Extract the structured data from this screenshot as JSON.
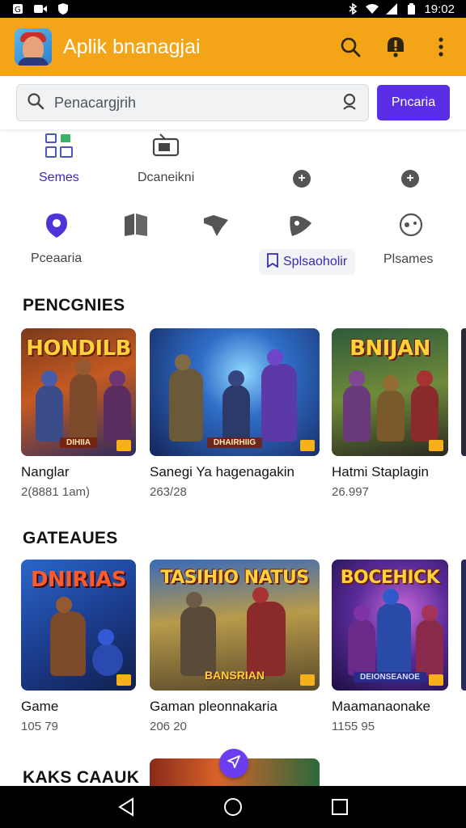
{
  "status_bar": {
    "time": "19:02"
  },
  "app_bar": {
    "title": "Aplik bnanagjai"
  },
  "search": {
    "placeholder": "Penacargjrih",
    "button_label": "Pncaria"
  },
  "categories_row1": [
    {
      "label": "Semes",
      "icon": "grid-apps-icon"
    },
    {
      "label": "Dcaneikni",
      "icon": "tv-icon"
    }
  ],
  "categories_row2": [
    {
      "label": "Pceaaria",
      "icon": "location-pin-icon"
    },
    {
      "label": "Splsaoholir",
      "icon": "bookmark-icon"
    },
    {
      "label": "Plsames",
      "icon": "gamepad-icon"
    }
  ],
  "sections": [
    {
      "title": "PENCGNIES",
      "cards": [
        {
          "thumb_title": "HONDILB",
          "thumb_banner": "DIHIIA",
          "name": "Nanglar",
          "meta": "2(8881 1am)"
        },
        {
          "thumb_title": "",
          "thumb_banner": "DHAIRHIIG",
          "name": "Sanegi Ya hagenagakin",
          "meta": "263/28"
        },
        {
          "thumb_title": "BNIJAN",
          "thumb_banner": "",
          "name": "Hatmi Staplagin",
          "meta": "26.997"
        }
      ]
    },
    {
      "title": "GATEAUES",
      "cards": [
        {
          "thumb_title": "DNIRIAS",
          "thumb_banner": "",
          "name": "Game",
          "meta": "105 79"
        },
        {
          "thumb_title": "TASIHIO NATUS",
          "thumb_banner": "BANSRIAN",
          "name": "Gaman pleonnakaria",
          "meta": "206 20"
        },
        {
          "thumb_title": "BOCEHICK",
          "thumb_banner": "DEIONSEANOE",
          "name": "Maamanaonake",
          "meta": "1155 95"
        }
      ]
    },
    {
      "title": "KAKS CAAUK"
    }
  ],
  "colors": {
    "app_bar": "#f4a517",
    "accent": "#5a2ee6"
  }
}
